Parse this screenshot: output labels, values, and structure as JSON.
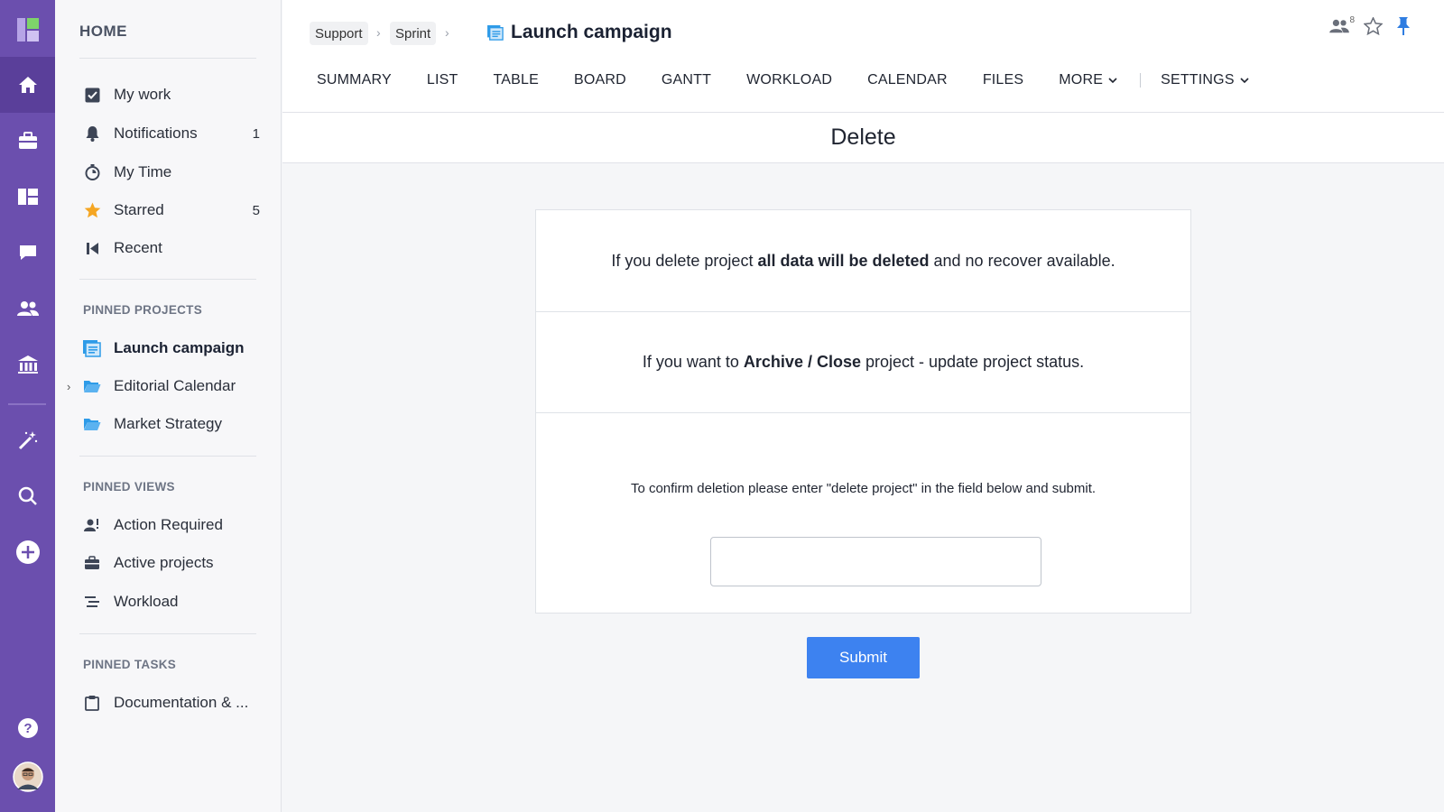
{
  "sidebar": {
    "home_label": "HOME",
    "items": [
      {
        "label": "My work",
        "count": ""
      },
      {
        "label": "Notifications",
        "count": "1"
      },
      {
        "label": "My Time",
        "count": ""
      },
      {
        "label": "Starred",
        "count": "5"
      },
      {
        "label": "Recent",
        "count": ""
      }
    ],
    "pinned_projects_heading": "PINNED PROJECTS",
    "pinned_projects": [
      {
        "label": "Launch campaign"
      },
      {
        "label": "Editorial Calendar"
      },
      {
        "label": "Market Strategy"
      }
    ],
    "pinned_views_heading": "PINNED VIEWS",
    "pinned_views": [
      {
        "label": "Action Required"
      },
      {
        "label": "Active projects"
      },
      {
        "label": "Workload"
      }
    ],
    "pinned_tasks_heading": "PINNED TASKS",
    "pinned_tasks": [
      {
        "label": "Documentation & ..."
      }
    ]
  },
  "header": {
    "breadcrumbs": [
      "Support",
      "Sprint"
    ],
    "title": "Launch campaign",
    "members_count": "8",
    "tabs": [
      "SUMMARY",
      "LIST",
      "TABLE",
      "BOARD",
      "GANTT",
      "WORKLOAD",
      "CALENDAR",
      "FILES",
      "MORE"
    ],
    "settings_label": "SETTINGS"
  },
  "page": {
    "subtitle": "Delete",
    "warning_pre": "If you delete project ",
    "warning_bold": "all data will be deleted",
    "warning_post": " and no recover available.",
    "archive_pre": "If you want to ",
    "archive_bold": "Archive / Close",
    "archive_post": " project - update project status.",
    "confirm_text": "To confirm deletion please enter \"delete project\" in the field below and submit.",
    "confirm_value": "",
    "submit_label": "Submit"
  },
  "colors": {
    "rail": "#6b4fae",
    "accent": "#3d82f0",
    "star": "#f5a623"
  }
}
